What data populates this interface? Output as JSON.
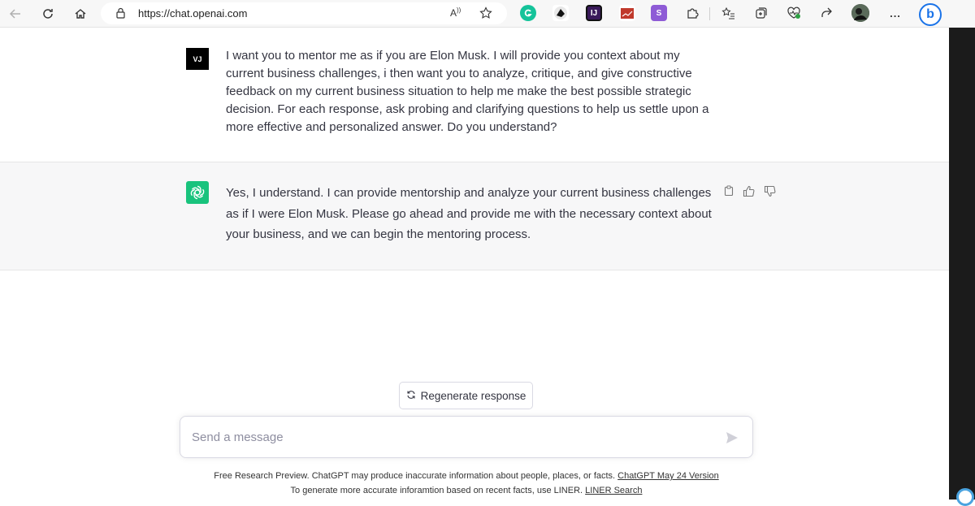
{
  "browser": {
    "url": "https://chat.openai.com",
    "read_aloud_label": "A",
    "ext_4_label": "IJ",
    "ext_6_label": "S",
    "menu_label": "...",
    "bing_label": "b"
  },
  "conversation": {
    "user_avatar": "VJ",
    "user_message": "I want you to mentor me as if you are Elon Musk. I will provide you context about my current business challenges, i then want you to analyze, critique, and give constructive feedback on my current business situation to help me make the best possible strategic decision. For each response, ask probing and clarifying questions to help us settle upon a more effective and personalized answer. Do you understand?",
    "assistant_message": "Yes, I understand. I can provide mentorship and analyze your current business challenges as if I were Elon Musk. Please go ahead and provide me with the necessary context about your business, and we can begin the mentoring process."
  },
  "composer": {
    "regenerate_label": "Regenerate response",
    "placeholder": "Send a message"
  },
  "footer": {
    "line1_text": "Free Research Preview. ChatGPT may produce inaccurate information about people, places, or facts. ",
    "line1_link": "ChatGPT May 24 Version",
    "line2_text": "To generate more accurate inforamtion based on recent facts, use LINER. ",
    "line2_link": "LINER Search"
  },
  "colors": {
    "assistant_avatar_bg": "#19c37d",
    "bot_row_bg": "#f7f7f8",
    "text": "#343541"
  }
}
